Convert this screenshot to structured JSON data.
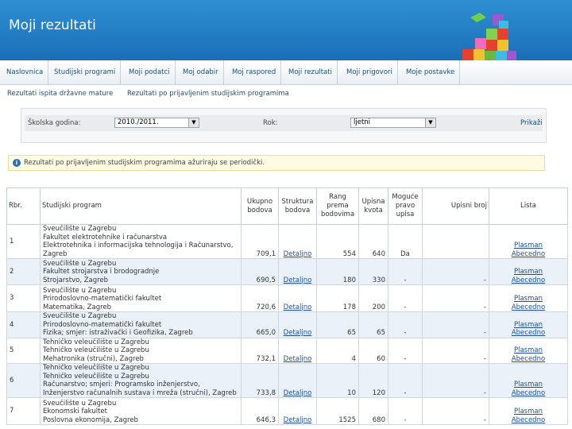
{
  "header": {
    "title": "Moji rezultati",
    "logo_icon": "colored-cubes-logo"
  },
  "nav": [
    "Naslovnica",
    "Studijski programi",
    "Moji podatci",
    "Moj odabir",
    "Moj raspored",
    "Moji rezultati",
    "Moji prigovori",
    "Moje postavke"
  ],
  "subtabs": [
    "Rezultati ispita državne mature",
    "Rezultati po prijavljenim studijskim programima"
  ],
  "filter": {
    "year_label": "Školska godina:",
    "year_value": "2010./2011.",
    "term_label": "Rok:",
    "term_value": "ljetni",
    "show_label": "Prikaži"
  },
  "notice": {
    "icon": "info-icon",
    "text": "Rezultati po prijavljenim studijskim programima ažuriraju se periodički."
  },
  "table": {
    "headers": {
      "rbr": "Rbr.",
      "program": "Studijski program",
      "ukupno": "Ukupno bodova",
      "struktura": "Struktura bodova",
      "rang": "Rang prema bodovima",
      "kvota": "Upisna kvota",
      "moguce": "Moguće pravo upisa",
      "upisni": "Upisni broj",
      "lista": "Lista"
    },
    "rows": [
      {
        "rbr": "1",
        "program": [
          "Sveučilište u Zagrebu",
          "Fakultet elektrotehnike i računarstva",
          "Elektrotehnika i informacijska tehnologija i Računarstvo,",
          "Zagreb"
        ],
        "ukupno": "709,1",
        "struktura": "Detaljno",
        "rang": "554",
        "kvota": "640",
        "moguce": "Da",
        "upisni": "",
        "lista": [
          "Plasman",
          "Abecedno"
        ]
      },
      {
        "rbr": "2",
        "program": [
          "Sveučilište u Zagrebu",
          "Fakultet strojarstva i brodogradnje",
          "Strojarstvo, Zagreb"
        ],
        "ukupno": "690,5",
        "struktura": "Detaljno",
        "rang": "180",
        "kvota": "330",
        "moguce": "-",
        "upisni": "-",
        "lista": [
          "Plasman",
          "Abecedno"
        ]
      },
      {
        "rbr": "3",
        "program": [
          "Sveučilište u Zagrebu",
          "Prirodoslovno-matematički fakultet",
          "Matematika, Zagreb"
        ],
        "ukupno": "720,6",
        "struktura": "Detaljno",
        "rang": "178",
        "kvota": "200",
        "moguce": "-",
        "upisni": "-",
        "lista": [
          "Plasman",
          "Abecedno"
        ]
      },
      {
        "rbr": "4",
        "program": [
          "Sveučilište u Zagrebu",
          "Prirodoslovno-matematički fakultet",
          "Fizika; smjer: istraživački i Geofizika, Zagreb"
        ],
        "ukupno": "665,0",
        "struktura": "Detaljno",
        "rang": "65",
        "kvota": "65",
        "moguce": "-",
        "upisni": "-",
        "lista": [
          "Plasman",
          "Abecedno"
        ]
      },
      {
        "rbr": "5",
        "program": [
          "Tehničko veleučilište u Zagrebu",
          "Tehničko veleučilište u Zagrebu",
          "Mehatronika (stručni), Zagreb"
        ],
        "ukupno": "732,1",
        "struktura": "Detaljno",
        "rang": "4",
        "kvota": "60",
        "moguce": "-",
        "upisni": "-",
        "lista": [
          "Plasman",
          "Abecedno"
        ]
      },
      {
        "rbr": "6",
        "program": [
          "Tehničko veleučilište u Zagrebu",
          "Tehničko veleučilište u Zagrebu",
          "Računarstvo; smjeri: Programsko inženjerstvo,",
          "Inženjerstvo računalnih sustava i mreža (stručni), Zagreb"
        ],
        "ukupno": "733,8",
        "struktura": "Detaljno",
        "rang": "10",
        "kvota": "120",
        "moguce": "-",
        "upisni": "-",
        "lista": [
          "Plasman",
          "Abecedno"
        ]
      },
      {
        "rbr": "7",
        "program": [
          "Sveučilište u Zagrebu",
          "Ekonomski fakultet",
          "Poslovna ekonomija, Zagreb"
        ],
        "ukupno": "646,3",
        "struktura": "Detaljno",
        "rang": "1525",
        "kvota": "680",
        "moguce": "-",
        "upisni": "-",
        "lista": [
          "Plasman",
          "Abecedno"
        ]
      }
    ]
  }
}
